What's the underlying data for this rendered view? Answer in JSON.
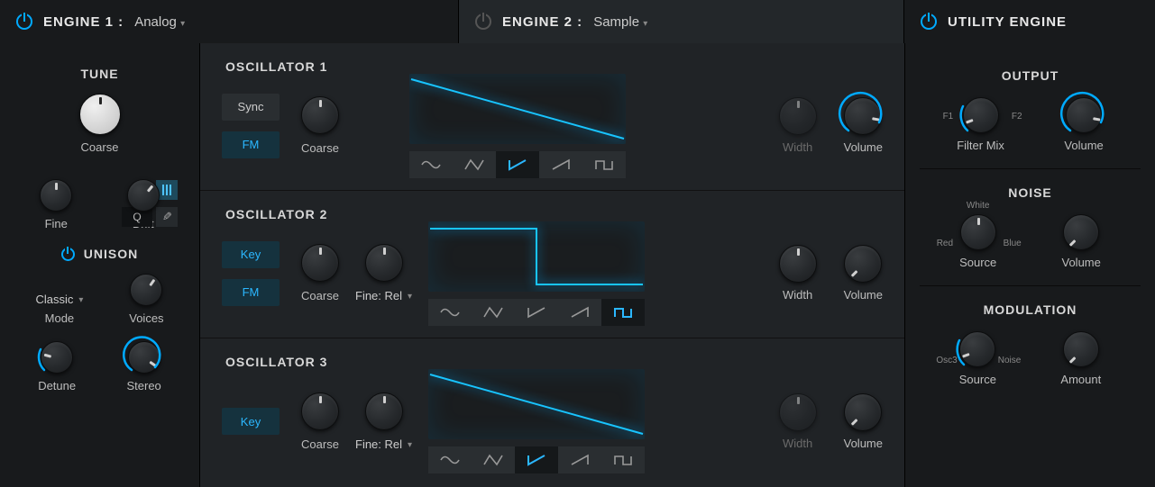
{
  "engine1": {
    "label": "ENGINE 1 :",
    "type": "Analog",
    "power": true
  },
  "engine2": {
    "label": "ENGINE 2 :",
    "type": "Sample",
    "power": false
  },
  "utility": {
    "label": "UTILITY ENGINE",
    "power": true
  },
  "tune": {
    "title": "TUNE",
    "coarse": "Coarse",
    "fine": "Fine",
    "drift": "Drift",
    "q": "Q"
  },
  "unison": {
    "title": "UNISON",
    "power": true,
    "mode_value": "Classic",
    "mode": "Mode",
    "voices": "Voices",
    "detune": "Detune",
    "stereo": "Stereo"
  },
  "osc": {
    "o1": {
      "title": "OSCILLATOR 1",
      "btn1": "Sync",
      "btn1_on": false,
      "btn2": "FM",
      "btn2_on": true,
      "coarse": "Coarse",
      "fine": null,
      "wave_sel": 2,
      "width": "Width",
      "width_dim": true,
      "volume": "Volume"
    },
    "o2": {
      "title": "OSCILLATOR 2",
      "btn1": "Key",
      "btn1_on": true,
      "btn2": "FM",
      "btn2_on": true,
      "coarse": "Coarse",
      "fine": "Fine: Rel",
      "wave_sel": 4,
      "width": "Width",
      "width_dim": false,
      "volume": "Volume"
    },
    "o3": {
      "title": "OSCILLATOR 3",
      "btn1": "Key",
      "btn1_on": true,
      "btn2": null,
      "coarse": "Coarse",
      "fine": "Fine: Rel",
      "wave_sel": 2,
      "width": "Width",
      "width_dim": true,
      "volume": "Volume"
    }
  },
  "output": {
    "title": "OUTPUT",
    "filtermix": "Filter Mix",
    "f1": "F1",
    "f2": "F2",
    "volume": "Volume"
  },
  "noise": {
    "title": "NOISE",
    "source": "Source",
    "red": "Red",
    "white": "White",
    "blue": "Blue",
    "volume": "Volume"
  },
  "mod": {
    "title": "MODULATION",
    "source": "Source",
    "osc3": "Osc3",
    "noise": "Noise",
    "amount": "Amount"
  }
}
